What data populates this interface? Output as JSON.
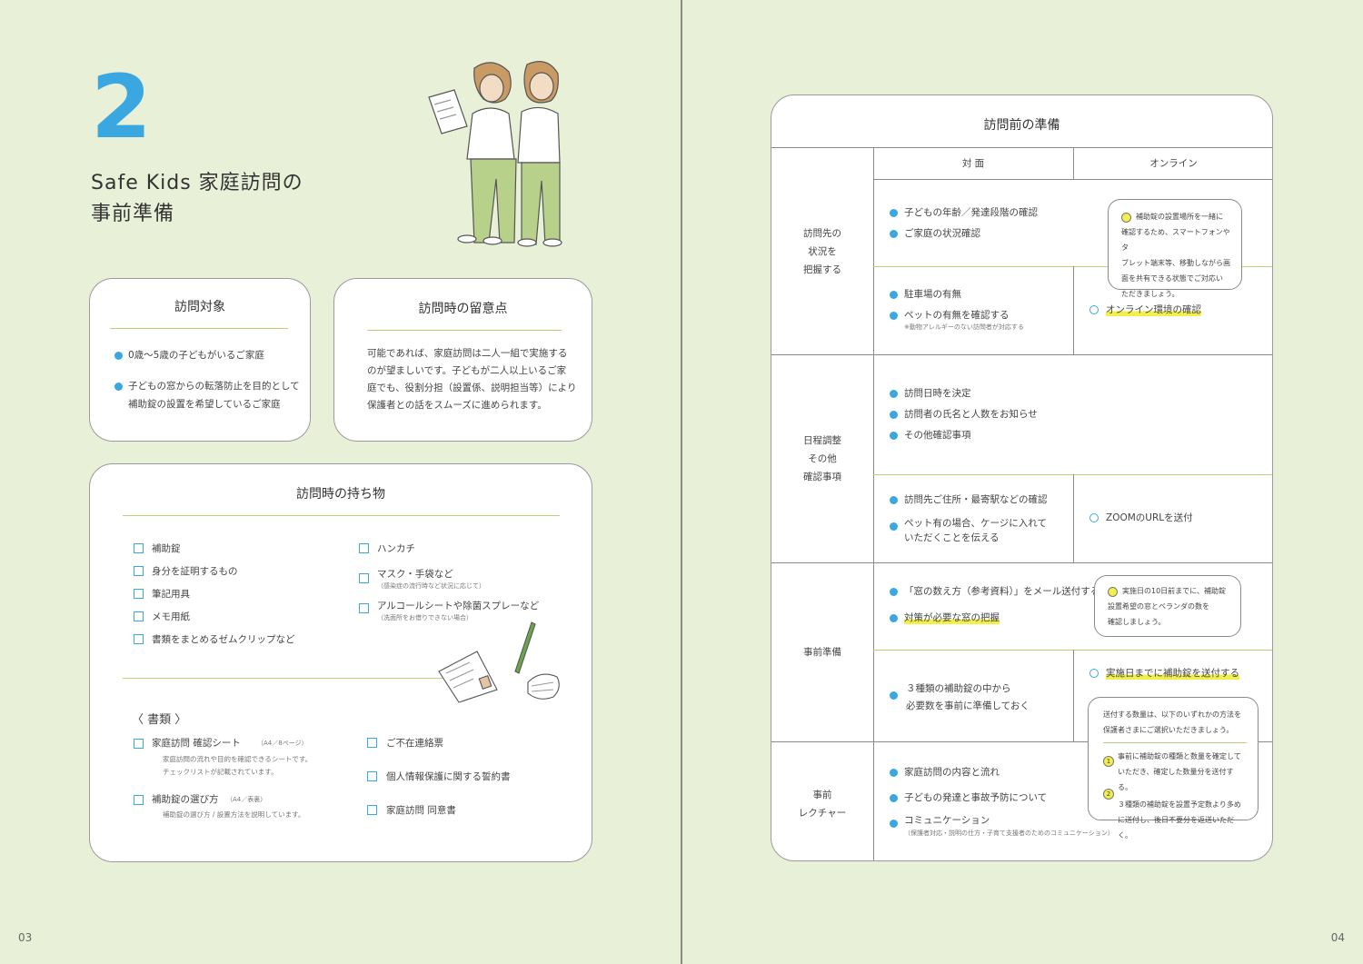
{
  "left": {
    "number": "2",
    "title_line1": "Safe Kids 家庭訪問の",
    "title_line2": "事前準備",
    "page_number": "03",
    "target": {
      "heading": "訪問対象",
      "items": [
        "0歳～5歳の子どもがいるご家庭",
        "子どもの窓からの転落防止を目的として",
        "補助錠の設置を希望しているご家庭"
      ]
    },
    "notes": {
      "heading": "訪問時の留意点",
      "lines": [
        "可能であれば、家庭訪問は二人一組で実施する",
        "のが望ましいです。子どもが二人以上いるご家",
        "庭でも、役割分担（設置係、説明担当等）により",
        "保護者との話をスムーズに進められます。"
      ]
    },
    "belongings": {
      "heading": "訪問時の持ち物",
      "col1": [
        "補助錠",
        "身分を証明するもの",
        "筆記用具",
        "メモ用紙",
        "書類をまとめるゼムクリップなど"
      ],
      "col2": [
        {
          "label": "ハンカチ",
          "note": ""
        },
        {
          "label": "マスク・手袋など",
          "note": "（感染症の流行時など状況に応じて）"
        },
        {
          "label": "アルコールシートや除菌スプレーなど",
          "note": "（洗面所をお借りできない場合）"
        }
      ],
      "docs_heading": "〈 書類 〉",
      "docs_col1": [
        {
          "label": "家庭訪問 確認シート",
          "size": "（A4／8ページ）",
          "desc1": "家庭訪問の流れや目的を確認できるシートです。",
          "desc2": "チェックリストが記載されています。"
        },
        {
          "label": "補助錠の選び方",
          "size": "（A4／表裏）",
          "desc1": "補助錠の選び方 / 設置方法を説明しています。",
          "desc2": ""
        }
      ],
      "docs_col2": [
        "ご不在連絡票",
        "個人情報保護に関する誓約書",
        "家庭訪問 同意書"
      ]
    }
  },
  "right": {
    "page_number": "04",
    "table_title": "訪問前の準備",
    "col_face": "対 面",
    "col_online": "オンライン",
    "row1": {
      "label": [
        "訪問先の",
        "状況を",
        "把握する"
      ],
      "top": [
        "子どもの年齢／発達段階の確認",
        "ご家庭の状況確認"
      ],
      "bottom": [
        "駐車場の有無",
        "ペットの有無を確認する"
      ],
      "bottom_note": "※動物アレルギーのない訪問者が対応する",
      "bubble": [
        "補助錠の設置場所を一緒に",
        "確認するため、スマートフォンやタ",
        "ブレット端末等、移動しながら画",
        "面を共有できる状態でご対応い",
        "ただきましょう。"
      ],
      "online": "オンライン環境の確認"
    },
    "row2": {
      "label": [
        "日程調整",
        "その他",
        "確認事項"
      ],
      "top": [
        "訪問日時を決定",
        "訪問者の氏名と人数をお知らせ",
        "その他確認事項"
      ],
      "bottom1": "訪問先ご住所・最寄駅などの確認",
      "bottom2a": "ペット有の場合、ケージに入れて",
      "bottom2b": "いただくことを伝える",
      "online": "ZOOMのURLを送付"
    },
    "row3": {
      "label": "事前準備",
      "top1": "「窓の数え方（参考資料）」をメール送付する",
      "top2": "対策が必要な窓の把握",
      "bubble": [
        "実施日の10日前までに、補助錠",
        "設置希望の窓とベランダの数を",
        "確認しましょう。"
      ],
      "bottom_a": "３種類の補助錠の中から",
      "bottom_b": "必要数を事前に準備しておく",
      "online": "実施日までに補助錠を送付する",
      "send_bubble": {
        "lines": [
          "送付する数量は、以下のいずれかの方法を",
          "保護者さまにご選択いただきましょう。"
        ],
        "opt1": [
          "事前に補助錠の種類と数量を確定して",
          "いただき、確定した数量分を送付する。"
        ],
        "opt2": [
          "３種類の補助錠を設置予定数より多め",
          "に送付し、後日不要分を返送いただく。"
        ],
        "n1": "1",
        "n2": "2"
      }
    },
    "row4": {
      "label": [
        "事前",
        "レクチャー"
      ],
      "items": [
        "家庭訪問の内容と流れ",
        "子どもの発達と事故予防について",
        "コミュニケーション"
      ],
      "note": "（保護者対応・説明の仕方・子育て支援者のためのコミュニケーション）"
    }
  },
  "colors": {
    "accent_blue": "#3aa7e0",
    "green_line": "#b7d47a",
    "highlight": "#f2ee4a",
    "background": "#e8f0d8"
  }
}
